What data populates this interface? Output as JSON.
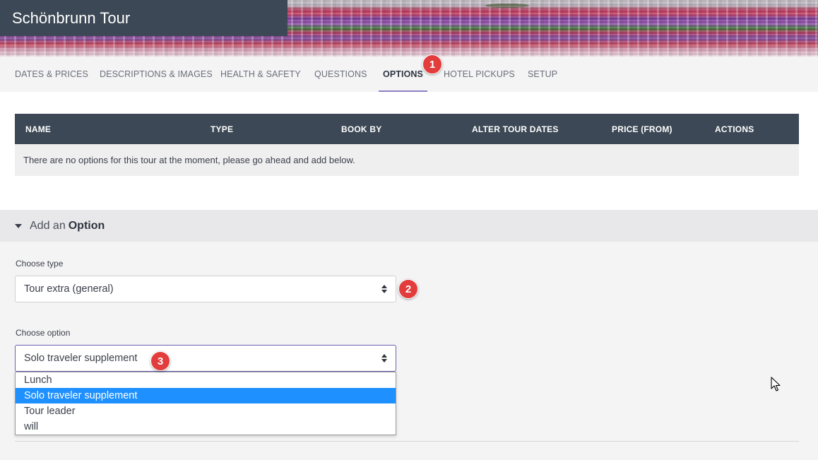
{
  "header": {
    "title": "Schönbrunn Tour"
  },
  "tabs": [
    {
      "label": "DATES & PRICES"
    },
    {
      "label": "DESCRIPTIONS & IMAGES"
    },
    {
      "label": "HEALTH & SAFETY"
    },
    {
      "label": "QUESTIONS"
    },
    {
      "label": "OPTIONS",
      "active": true
    },
    {
      "label": "HOTEL PICKUPS"
    },
    {
      "label": "SETUP"
    }
  ],
  "options_table": {
    "columns": [
      "NAME",
      "TYPE",
      "BOOK BY",
      "ALTER TOUR DATES",
      "PRICE (FROM)",
      "ACTIONS"
    ],
    "empty_message": "There are no options for this tour at the moment, please go ahead and add below."
  },
  "add_option": {
    "heading_prefix": "Add an",
    "heading_strong": "Option",
    "type_label": "Choose type",
    "type_value": "Tour extra (general)",
    "option_label": "Choose option",
    "option_value": "Solo traveler supplement",
    "option_choices": [
      "Lunch",
      "Solo traveler supplement",
      "Tour leader",
      "will"
    ],
    "option_selected_index": 1
  },
  "markers": [
    "1",
    "2",
    "3"
  ],
  "colors": {
    "header_dark": "#3c4855",
    "tab_underline": "#8e7fc4",
    "marker_red": "#e23c3c",
    "dropdown_highlight": "#1e90ff"
  },
  "icons": {
    "section_toggle": "caret-down-icon",
    "select_arrows": "up-down-arrows-icon",
    "cursor": "mouse-pointer-icon"
  }
}
